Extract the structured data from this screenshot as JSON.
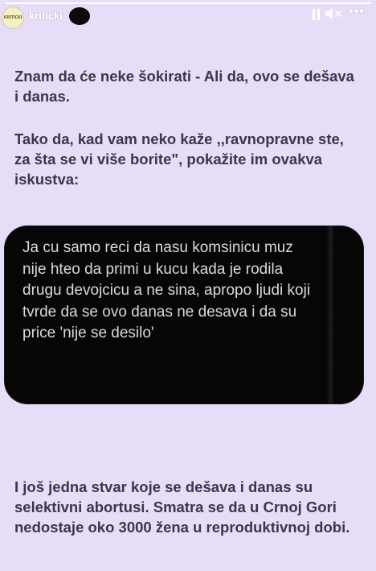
{
  "story": {
    "username": "kriticki",
    "avatar_text": "KRITICKI",
    "progress": 1.0,
    "icons": {
      "pause": "pause-icon",
      "mute": "speaker-muted-icon",
      "more": "more-options-icon"
    },
    "colors": {
      "background": "#e8ddf8",
      "text": "#3a3550",
      "bubble": "#060606",
      "bubble_text": "#d9d9d9"
    }
  },
  "content": {
    "para1": "Znam da će neke šokirati - Ali da, ovo se dešava i danas.",
    "para2": "Tako da, kad vam neko kaže ,,ravnopravne ste, za šta se vi više borite\", pokažite im ovakva iskustva:",
    "message": "Ja cu samo reci da nasu komsinicu muz nije hteo da primi u kucu kada je rodila drugu devojcicu a ne sina, apropo ljudi koji tvrde da se ovo danas ne desava i da su price 'nije se desilo'",
    "para3": "I još jedna stvar koje se dešava i danas su selektivni abortusi. Smatra se da u Crnoj Gori nedostaje oko 3000 žena u reproduktivnoj dobi."
  }
}
